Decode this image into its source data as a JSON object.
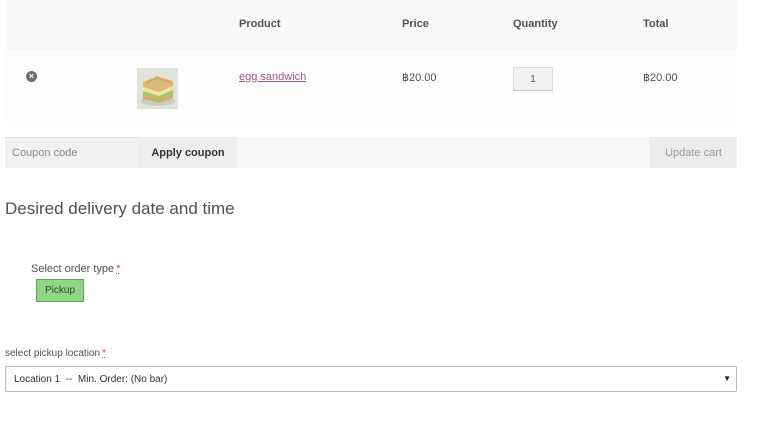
{
  "cart": {
    "headers": {
      "product": "Product",
      "price": "Price",
      "quantity": "Quantity",
      "total": "Total"
    },
    "items": [
      {
        "name": "egg sandwich",
        "price": "฿20.00",
        "quantity": "1",
        "total": "฿20.00",
        "remove_icon": "remove-circle-x",
        "thumbnail": "egg-sandwich-photo"
      }
    ]
  },
  "actions": {
    "coupon_placeholder": "Coupon code",
    "apply_coupon_label": "Apply coupon",
    "update_cart_label": "Update cart"
  },
  "delivery": {
    "heading": "Desired delivery date and time",
    "order_type_label": "Select order type",
    "required_mark": "*",
    "order_type_option": "Pickup",
    "location_label": "select pickup location",
    "location_selected": "Location 1  --  Min. Order: (No bar)",
    "caret_icon": "▼"
  },
  "colors": {
    "link": "#96588a",
    "required": "#e2401c",
    "pickup_button": "#8fd785",
    "text": "#515151"
  }
}
